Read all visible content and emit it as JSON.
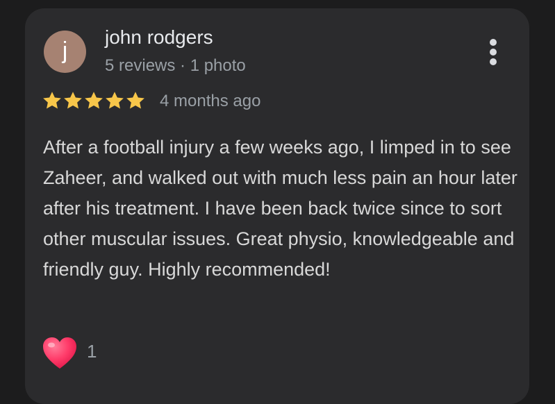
{
  "review": {
    "avatar_initial": "j",
    "author_name": "john rodgers",
    "author_meta": "5 reviews · 1 photo",
    "rating": 5,
    "rating_max": 5,
    "time_ago": "4 months ago",
    "text": "After a football injury a few weeks ago, I limped in to see Zaheer, and walked out with much less pain an hour later after his treatment. I have been back twice since to sort other muscular issues. Great physio, knowledgeable and friendly guy. Highly recommended!",
    "reaction_count": "1"
  },
  "icons": {
    "menu": "more-vertical-icon",
    "star": "star-icon",
    "reaction": "heart-icon"
  },
  "colors": {
    "page_background": "#1c1c1d",
    "card_background": "#2b2b2d",
    "avatar_background": "#a68272",
    "star": "#f7c64a",
    "heart": "#ff3b69",
    "primary_text": "#e8eaed",
    "secondary_text": "#9aa0a6"
  }
}
